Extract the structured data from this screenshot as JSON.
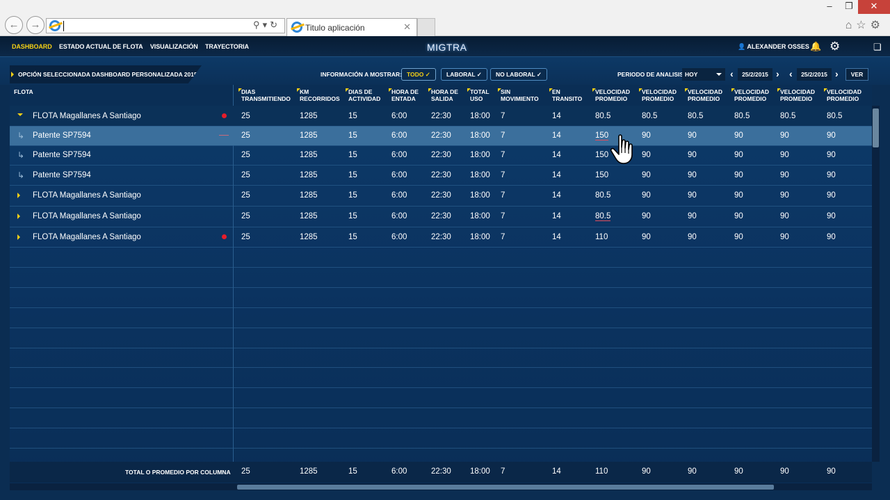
{
  "browser": {
    "tab_title": "Titulo aplicación",
    "address_value": ""
  },
  "app": {
    "logo": "MIGTRA",
    "menu": [
      "DASHBOARD",
      "ESTADO ACTUAL DE FLOTA",
      "VISUALIZACIÓN",
      "TRAYECTORIA"
    ],
    "user": "ALEXANDER OSSES"
  },
  "toolbar": {
    "option_label": "OPCIÓN SELECCIONADA DASHBOARD PERSONALIZADA 2015",
    "info_label": "INFORMACIÓN A MOSTRAR:",
    "filters": [
      "TODO",
      "LABORAL",
      "NO LABORAL"
    ],
    "periodo_label": "PERIODO DE ANALISIS",
    "periodo_value": "HOY",
    "date_from": "25/2/2015",
    "date_to": "25/2/2015",
    "ver_label": "VER"
  },
  "table": {
    "first_header": "FLOTA",
    "headers": [
      [
        "DIAS",
        "TRANSMITIENDO"
      ],
      [
        "KM",
        "RECORRIDOS"
      ],
      [
        "DIAS DE",
        "ACTIVIDAD"
      ],
      [
        "HORA DE",
        "ENTADA"
      ],
      [
        "HORA DE",
        "SALIDA"
      ],
      [
        "TOTAL",
        "USO"
      ],
      [
        "SIN",
        "MOVIMIENTO"
      ],
      [
        "EN",
        "TRANSITO"
      ],
      [
        "VELOCIDAD",
        "PROMEDIO"
      ],
      [
        "VELOCIDAD",
        "PROMEDIO"
      ],
      [
        "VELOCIDAD",
        "PROMEDIO"
      ],
      [
        "VELOCIDAD",
        "PROMEDIO"
      ],
      [
        "VELOCIDAD",
        "PROMEDIO"
      ],
      [
        "VELOCIDAD",
        "PROMEDIO"
      ]
    ],
    "rows": [
      {
        "name": "FLOTA Magallanes A Santiago",
        "values": [
          "25",
          "1285",
          "15",
          "6:00",
          "22:30",
          "18:00",
          "7",
          "14",
          "80.5",
          "80.5",
          "80.5",
          "80.5",
          "80.5",
          "80.5"
        ]
      },
      {
        "name": "Patente  SP7594",
        "values": [
          "25",
          "1285",
          "15",
          "6:00",
          "22:30",
          "18:00",
          "7",
          "14",
          "150",
          "90",
          "90",
          "90",
          "90",
          "90"
        ]
      },
      {
        "name": "Patente  SP7594",
        "values": [
          "25",
          "1285",
          "15",
          "6:00",
          "22:30",
          "18:00",
          "7",
          "14",
          "150",
          "90",
          "90",
          "90",
          "90",
          "90"
        ]
      },
      {
        "name": "Patente  SP7594",
        "values": [
          "25",
          "1285",
          "15",
          "6:00",
          "22:30",
          "18:00",
          "7",
          "14",
          "150",
          "90",
          "90",
          "90",
          "90",
          "90"
        ]
      },
      {
        "name": "FLOTA Magallanes A Santiago",
        "values": [
          "25",
          "1285",
          "15",
          "6:00",
          "22:30",
          "18:00",
          "7",
          "14",
          "80.5",
          "90",
          "90",
          "90",
          "90",
          "90"
        ]
      },
      {
        "name": "FLOTA Magallanes A Santiago",
        "values": [
          "25",
          "1285",
          "15",
          "6:00",
          "22:30",
          "18:00",
          "7",
          "14",
          "80.5",
          "90",
          "90",
          "90",
          "90",
          "90"
        ]
      },
      {
        "name": "FLOTA Magallanes A Santiago",
        "values": [
          "25",
          "1285",
          "15",
          "6:00",
          "22:30",
          "18:00",
          "7",
          "14",
          "110",
          "90",
          "90",
          "90",
          "90",
          "90"
        ]
      }
    ],
    "footer_label": "TOTAL O PROMEDIO POR COLUMNA",
    "footer_values": [
      "25",
      "1285",
      "15",
      "6:00",
      "22:30",
      "18:00",
      "7",
      "14",
      "110",
      "90",
      "90",
      "90",
      "90",
      "90"
    ]
  }
}
